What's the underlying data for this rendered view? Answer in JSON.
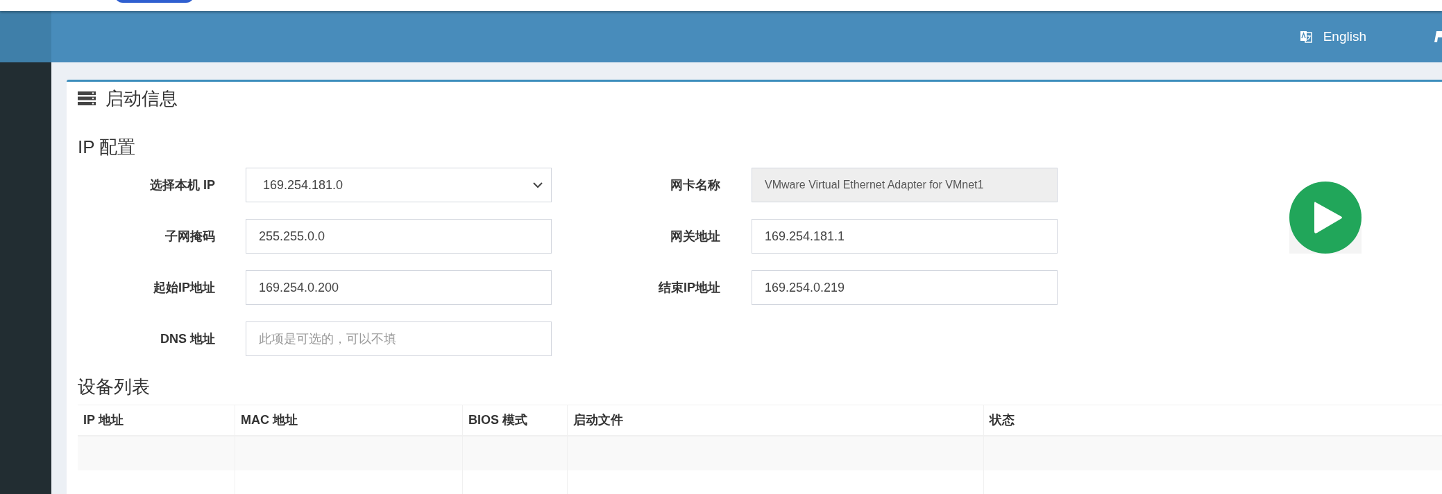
{
  "header": {
    "language": "English"
  },
  "card": {
    "title": "启动信息",
    "ip_config": {
      "title": "IP 配置",
      "fields": [
        {
          "kind": "select",
          "label": "选择本机 IP",
          "value": "169.254.181.0"
        },
        {
          "kind": "readonly",
          "label": "网卡名称",
          "value": "VMware Virtual Ethernet Adapter for VMnet1"
        },
        {
          "kind": "input",
          "label": "子网掩码",
          "value": "255.255.0.0"
        },
        {
          "kind": "input",
          "label": "网关地址",
          "value": "169.254.181.1"
        },
        {
          "kind": "input",
          "label": "起始IP地址",
          "value": "169.254.0.200"
        },
        {
          "kind": "input",
          "label": "结束IP地址",
          "value": "169.254.0.219"
        },
        {
          "kind": "input",
          "label": "DNS 地址",
          "placeholder": "此项是可选的，可以不填"
        }
      ]
    },
    "device_list": {
      "title": "设备列表",
      "columns": [
        "IP 地址",
        "MAC 地址",
        "BIOS 模式",
        "启动文件",
        "状态"
      ]
    }
  }
}
